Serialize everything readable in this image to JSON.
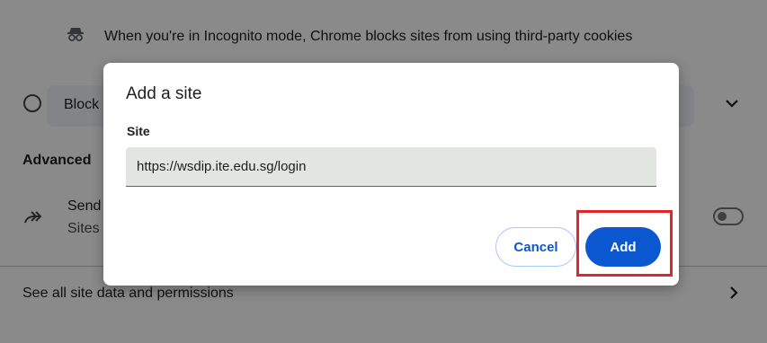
{
  "background": {
    "incognito_text": "When you're in Incognito mode, Chrome blocks sites from using third-party cookies",
    "block_text": "Block t",
    "advanced_heading": "Advanced",
    "send_title": "Send",
    "send_subtitle": "Sites",
    "see_all_text": "See all site data and permissions"
  },
  "dialog": {
    "title": "Add a site",
    "site_label": "Site",
    "site_value": "https://wsdip.ite.edu.sg/login",
    "cancel_label": "Cancel",
    "add_label": "Add"
  },
  "colors": {
    "accent": "#0b57d0",
    "highlight": "#e3242b"
  },
  "icons": [
    "incognito-icon",
    "chevron-down-icon",
    "forward-arrow-icon",
    "chevron-right-icon"
  ]
}
